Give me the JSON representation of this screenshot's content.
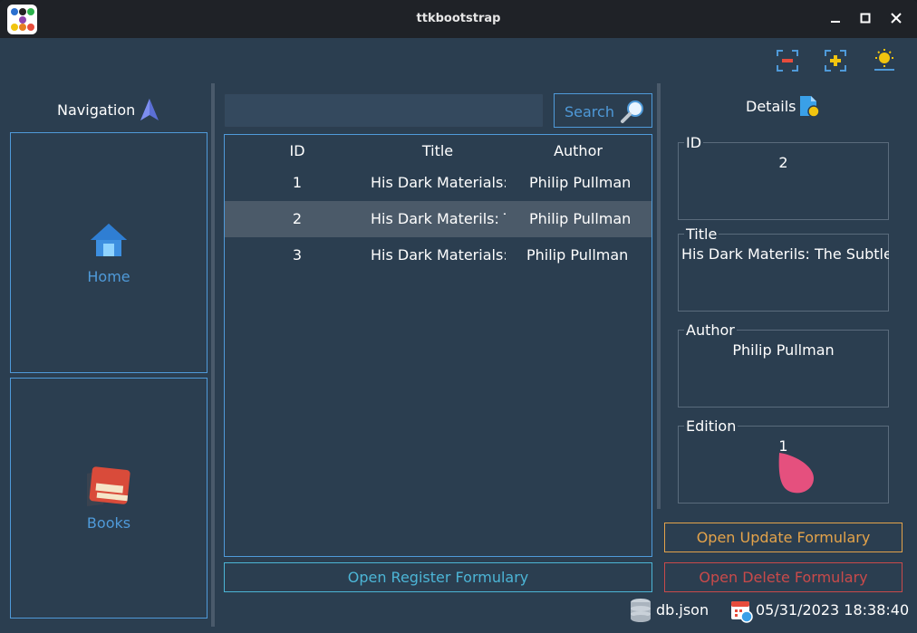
{
  "window": {
    "title": "ttkbootstrap"
  },
  "navigation": {
    "title": "Navigation",
    "items": [
      {
        "label": "Home",
        "icon": "home-icon"
      },
      {
        "label": "Books",
        "icon": "books-icon"
      }
    ]
  },
  "search": {
    "value": "",
    "placeholder": "",
    "button_label": "Search"
  },
  "table": {
    "columns": [
      "ID",
      "Title",
      "Author"
    ],
    "rows": [
      {
        "id": "1",
        "title": "His Dark Materials:",
        "author": "Philip Pullman"
      },
      {
        "id": "2",
        "title": "His Dark Materils: T",
        "author": "Philip Pullman"
      },
      {
        "id": "3",
        "title": "His Dark Materials:",
        "author": "Philip Pullman"
      }
    ],
    "selected_row": 1
  },
  "register_button": "Open Register Formulary",
  "details": {
    "title": "Details",
    "fields": [
      {
        "label": "ID",
        "value": "2"
      },
      {
        "label": "Title",
        "value": "His Dark Materils: The Subtle"
      },
      {
        "label": "Author",
        "value": "Philip Pullman"
      },
      {
        "label": "Edition",
        "value": "1"
      }
    ]
  },
  "update_button": "Open Update Formulary",
  "delete_button": "Open Delete Formulary",
  "status": {
    "db": "db.json",
    "datetime": "05/31/2023 18:38:40"
  },
  "colors": {
    "background": "#2b3e50",
    "primary": "#4f9ad9",
    "info": "#4cb5d6",
    "warning": "#e4a34a",
    "danger": "#c94a4a",
    "selected_row": "#4b5a69"
  }
}
